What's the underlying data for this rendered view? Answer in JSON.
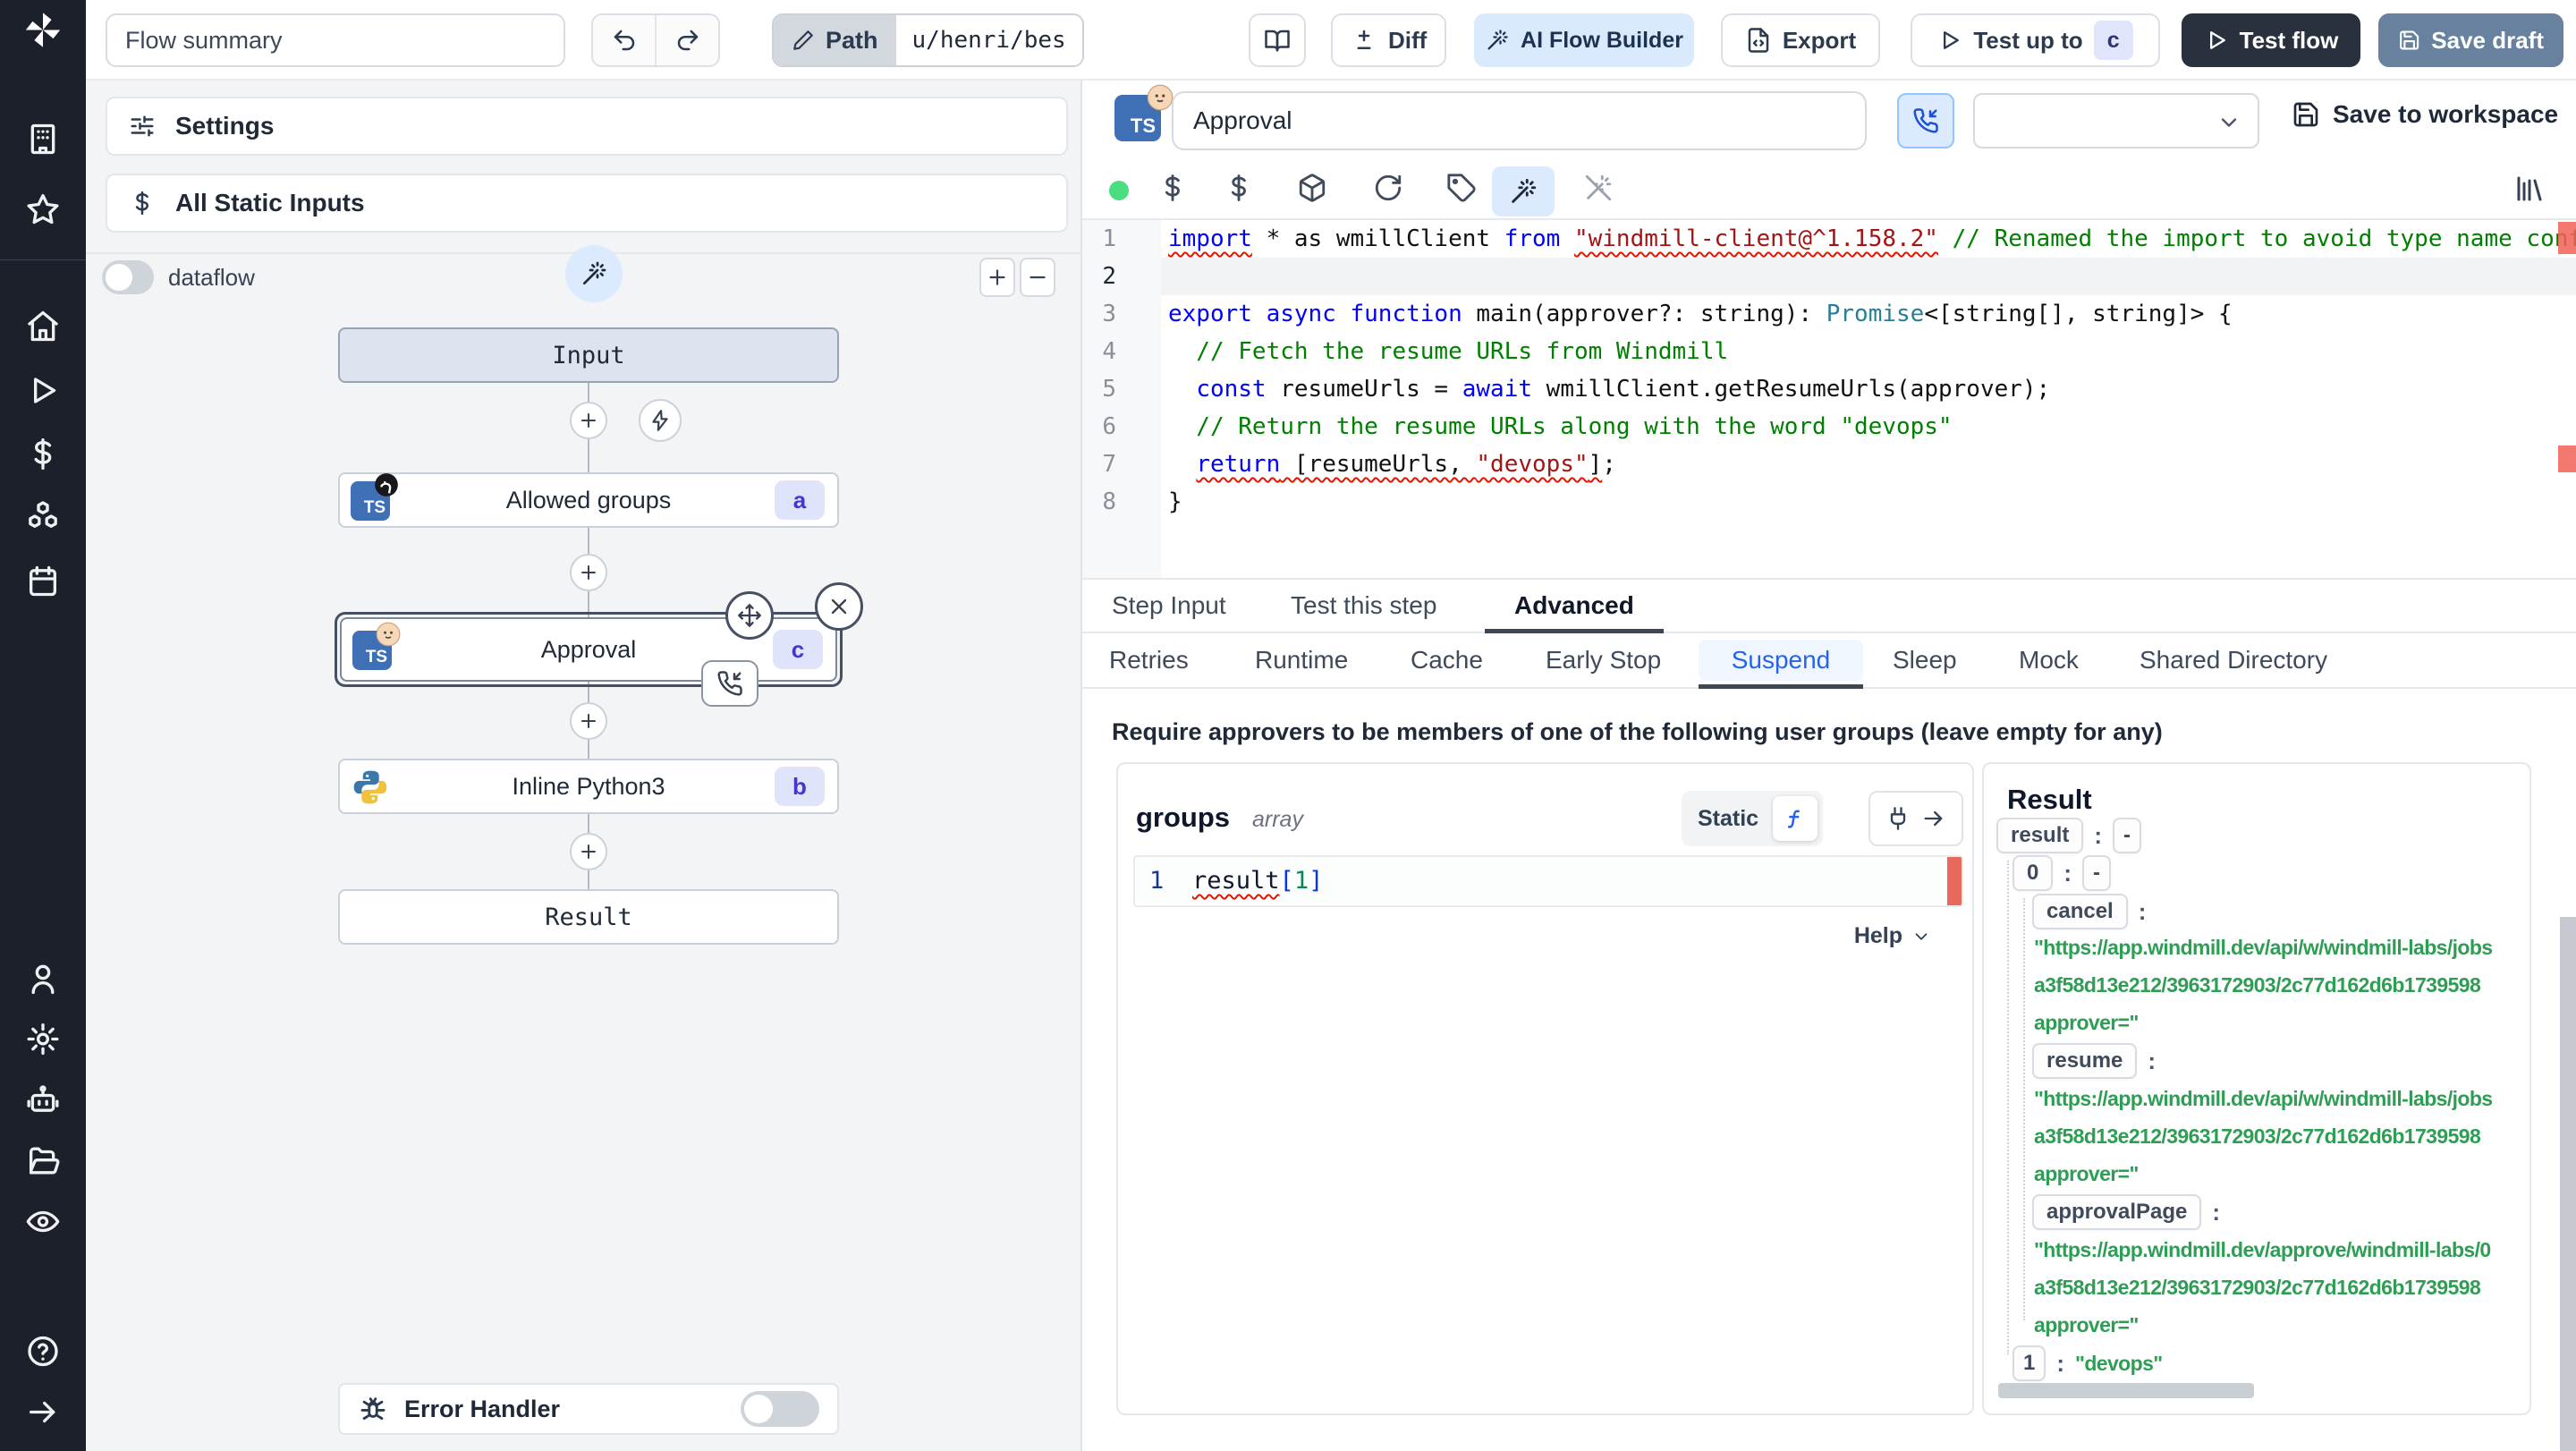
{
  "topbar": {
    "flow_summary": "Flow summary",
    "path_label": "Path",
    "path_value": "u/henri/bes",
    "diff": "Diff",
    "ai_builder": "AI Flow Builder",
    "export": "Export",
    "test_up_to": "Test up to",
    "test_up_to_key": "c",
    "test_flow": "Test flow",
    "save_draft": "Save draft"
  },
  "sidebar": {
    "icons": [
      "workspace",
      "favorites",
      "home",
      "runs",
      "variables",
      "resources",
      "schedules",
      "user",
      "settings",
      "workers",
      "folders",
      "audit-logs",
      "help",
      "collapse-sidebar"
    ]
  },
  "flow": {
    "settings": "Settings",
    "static_inputs": "All Static Inputs",
    "dataflow": "dataflow",
    "nodes": {
      "input": "Input",
      "allowed": {
        "label": "Allowed groups",
        "badge": "a",
        "lang": "TS"
      },
      "approval": {
        "label": "Approval",
        "badge": "c",
        "lang": "TS"
      },
      "python": {
        "label": "Inline Python3",
        "badge": "b"
      },
      "result": "Result"
    },
    "error_handler": "Error Handler"
  },
  "step": {
    "name": "Approval",
    "lang": "TS",
    "save_to_workspace": "Save to workspace"
  },
  "editor": {
    "numbers": [
      "1",
      "2",
      "3",
      "4",
      "5",
      "6",
      "7",
      "8"
    ],
    "lines": [
      [
        [
          "import",
          "kw sq"
        ],
        [
          " * as wmillClient ",
          ""
        ],
        [
          "from",
          "kw"
        ],
        [
          " ",
          ""
        ],
        [
          "\"windmill-client@^1.158.2\"",
          "str sq"
        ],
        [
          " ",
          ""
        ],
        [
          "// Renamed the import to avoid type name conflicts",
          "com"
        ]
      ],
      [],
      [
        [
          "export async function",
          "kw"
        ],
        [
          " main(approver?: string): ",
          ""
        ],
        [
          "Promise",
          "typ"
        ],
        [
          "<[string[], string]> {",
          ""
        ]
      ],
      [
        [
          "  // Fetch the resume URLs from Windmill",
          "com"
        ]
      ],
      [
        [
          "  ",
          ""
        ],
        [
          "const",
          "kw"
        ],
        [
          " resumeUrls = ",
          ""
        ],
        [
          "await",
          "kw"
        ],
        [
          " wmillClient.getResumeUrls(approver);",
          ""
        ]
      ],
      [
        [
          "  // Return the resume URLs along with the word \"devops\"",
          "com"
        ]
      ],
      [
        [
          "  ",
          ""
        ],
        [
          "return",
          "kw sq"
        ],
        [
          " [resumeUrls, ",
          "sq"
        ],
        [
          "\"devops\"",
          "str sq"
        ],
        [
          "]",
          "sq"
        ],
        [
          ";",
          ""
        ]
      ],
      [
        [
          "}",
          ""
        ]
      ]
    ]
  },
  "tabs": {
    "items": [
      "Step Input",
      "Test this step",
      "Advanced"
    ],
    "active": "Advanced"
  },
  "subtabs": {
    "items": [
      "Retries",
      "Runtime",
      "Cache",
      "Early Stop",
      "Suspend",
      "Sleep",
      "Mock",
      "Shared Directory"
    ],
    "active": "Suspend"
  },
  "suspend": {
    "heading": "Require approvers to be members of one of the following user groups (leave empty for any)",
    "field": "groups",
    "type": "array",
    "static_label": "Static",
    "line_no": "1",
    "code": [
      [
        "result",
        "sq"
      ],
      [
        "[",
        "blu"
      ],
      [
        "1",
        "grn"
      ],
      [
        "]",
        "blu"
      ]
    ],
    "help": "Help"
  },
  "result": {
    "title": "Result",
    "entries": [
      {
        "key": "result",
        "value": "-"
      },
      {
        "key": "0",
        "value": "-"
      },
      {
        "key": "cancel",
        "lines": [
          "\"https://app.windmill.dev/api/w/windmill-labs/jobs",
          "a3f58d13e212/3963172903/2c77d162d6b1739598",
          "approver=\""
        ]
      },
      {
        "key": "resume",
        "lines": [
          "\"https://app.windmill.dev/api/w/windmill-labs/jobs",
          "a3f58d13e212/3963172903/2c77d162d6b1739598",
          "approver=\""
        ]
      },
      {
        "key": "approvalPage",
        "lines": [
          "\"https://app.windmill.dev/approve/windmill-labs/0",
          "a3f58d13e212/3963172903/2c77d162d6b1739598",
          "approver=\""
        ]
      },
      {
        "key": "1",
        "value": "\"devops\""
      }
    ]
  }
}
